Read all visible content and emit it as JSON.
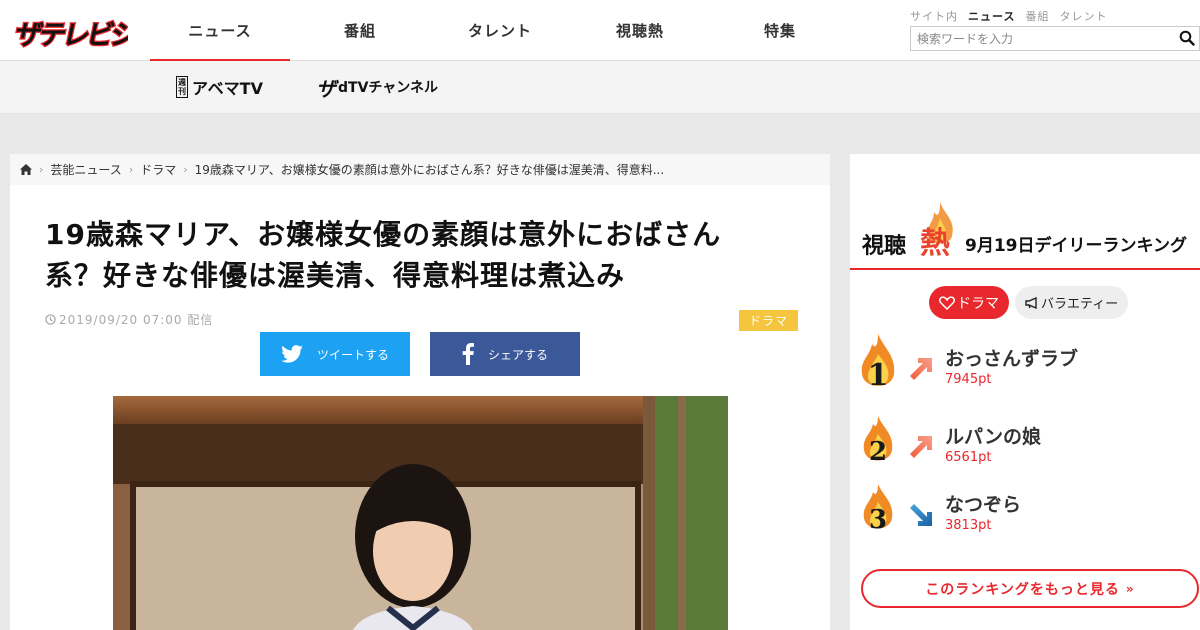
{
  "brand": {
    "logo_text": "ザテレビジョン",
    "accent": "#e8282d"
  },
  "nav": {
    "items": [
      {
        "label": "ニュース",
        "active": true
      },
      {
        "label": "番組",
        "active": false
      },
      {
        "label": "タレント",
        "active": false
      },
      {
        "label": "視聴熱",
        "active": false
      },
      {
        "label": "特集",
        "active": false
      }
    ]
  },
  "search": {
    "scopes": [
      {
        "label": "サイト内"
      },
      {
        "label": "ニュース"
      },
      {
        "label": "番組"
      },
      {
        "label": "タレント"
      }
    ],
    "active_scope": "ニュース",
    "placeholder": "検索ワードを入力"
  },
  "subnav": {
    "abema_weekly": "週刊",
    "abema": "アベマTV",
    "dtv_za": "ザ",
    "dtv": "dTVチャンネル"
  },
  "breadcrumb": [
    {
      "label": "芸能ニュース"
    },
    {
      "label": "ドラマ"
    },
    {
      "label": "19歳森マリア、お嬢様女優の素顔は意外におばさん系？好きな俳優は渥美清、得意料..."
    }
  ],
  "article": {
    "title_line1": "19歳森マリア、お嬢様女優の素顔は意外におばさん",
    "title_line2": "系？好きな俳優は渥美清、得意料理は煮込み",
    "date": "2019/09/20 07:00 配信",
    "tag": "ドラマ",
    "share_twitter": "ツイートする",
    "share_facebook": "シェアする"
  },
  "ranking": {
    "title_pre": "視聴",
    "title_hot": "熱",
    "date_label": "9月19日デイリーランキング",
    "tabs": [
      {
        "label": "ドラマ",
        "active": true
      },
      {
        "label": "バラエティー",
        "active": false
      }
    ],
    "items": [
      {
        "rank": "1",
        "name": "おっさんずラブ",
        "points": "7945pt",
        "trend": "up"
      },
      {
        "rank": "2",
        "name": "ルパンの娘",
        "points": "6561pt",
        "trend": "up"
      },
      {
        "rank": "3",
        "name": "なつぞら",
        "points": "3813pt",
        "trend": "down"
      }
    ],
    "more_label": "このランキングをもっと見る"
  }
}
